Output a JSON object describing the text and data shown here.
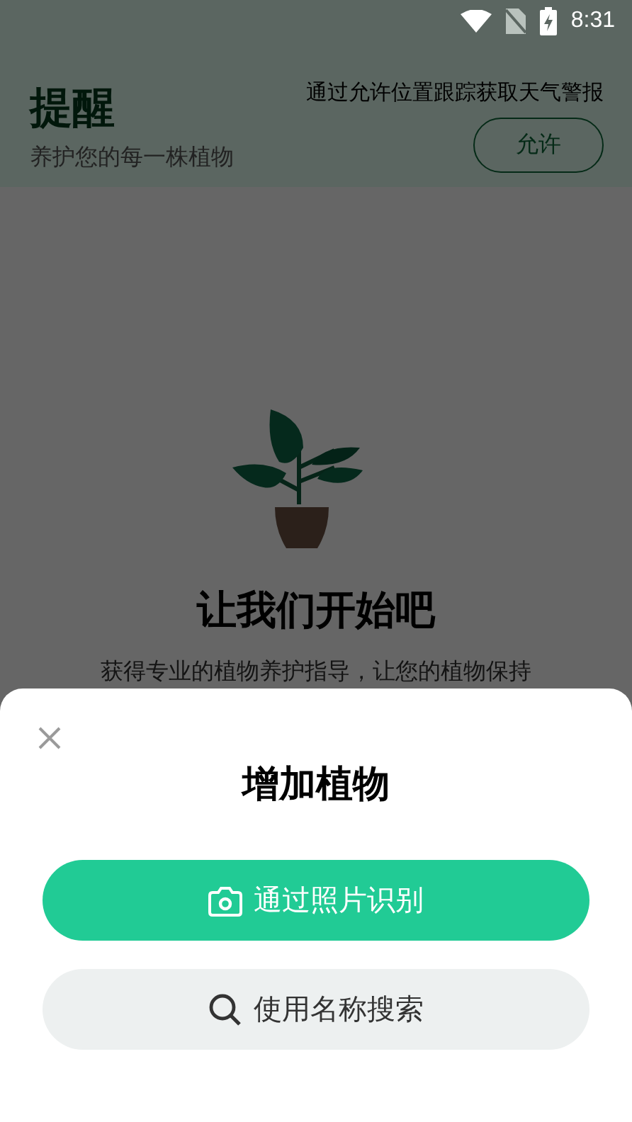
{
  "status_bar": {
    "time": "8:31"
  },
  "header": {
    "title": "提醒",
    "subtitle": "养护您的每一株植物",
    "weather_prompt": "通过允许位置跟踪获取天气警报",
    "allow_button": "允许"
  },
  "empty_state": {
    "heading": "让我们开始吧",
    "description": "获得专业的植物养护指导，让您的植物保持"
  },
  "sheet": {
    "title": "增加植物",
    "options": [
      {
        "kind": "camera",
        "label": "通过照片识别",
        "primary": true
      },
      {
        "kind": "search",
        "label": "使用名称搜索",
        "primary": false
      }
    ]
  }
}
